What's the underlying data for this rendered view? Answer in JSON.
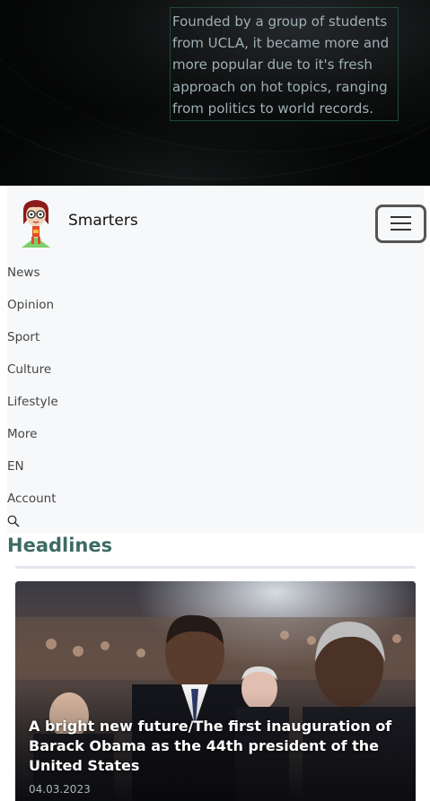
{
  "hero": {
    "description": "Founded by a group of students from UCLA, it became more and more popular due to it's fresh approach on hot topics, ranging from politics to world records."
  },
  "navbar": {
    "brand_name": "Smarters",
    "items": [
      {
        "label": "News"
      },
      {
        "label": "Opinion"
      },
      {
        "label": "Sport"
      },
      {
        "label": "Culture"
      },
      {
        "label": "Lifestyle"
      },
      {
        "label": "More"
      },
      {
        "label": "EN"
      },
      {
        "label": "Account"
      }
    ]
  },
  "main": {
    "section_title": "Headlines",
    "articles": [
      {
        "title": "A bright new future/The first inauguration of Barack Obama as the 44th president of the United States",
        "date": "04.03.2023"
      }
    ]
  },
  "colors": {
    "hero_bg": "#050606",
    "navbar_bg": "#f7f8fa",
    "heading_accent": "#3e6b63",
    "hero_text": "#9fb0b6"
  },
  "icons": {
    "logo": "girl-mascot-logo",
    "menu": "hamburger-icon",
    "search": "search-icon"
  }
}
